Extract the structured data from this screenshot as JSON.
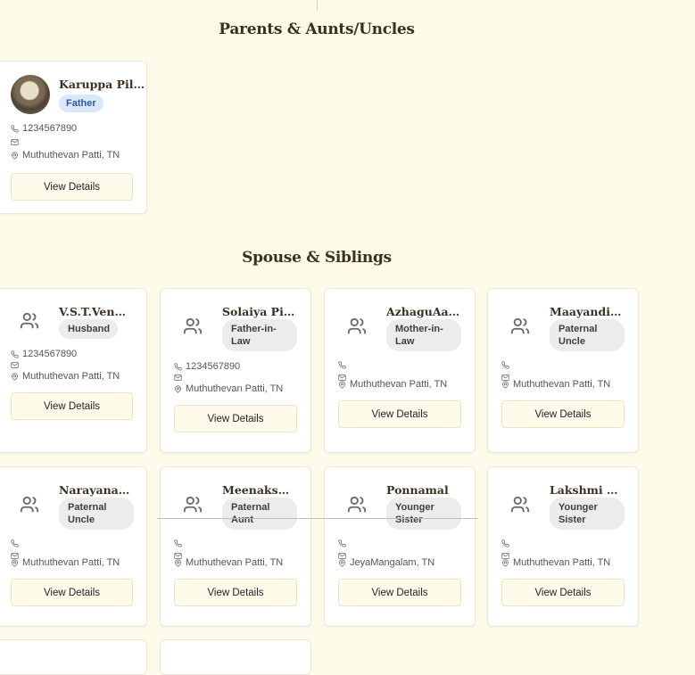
{
  "sections": {
    "parents": "Parents & Aunts/Uncles",
    "spouse": "Spouse & Siblings"
  },
  "view_details_label": "View Details",
  "icons": {
    "phone": "phone-icon",
    "email": "mail-icon",
    "location": "map-pin-icon",
    "avatar": "users-icon"
  },
  "colors": {
    "background": "#fefbea",
    "card": "#ffffff",
    "badge_blue_bg": "#dbe7fa",
    "badge_blue_text": "#2e59a8",
    "badge_gray_bg": "#ececec"
  },
  "parents": [
    {
      "name": "Karuppa Pillai",
      "relation": "Father",
      "phone": "1234567890",
      "email": "",
      "location": "Muthuthevan Patti, TN"
    }
  ],
  "spouse_siblings": [
    {
      "name": "V.S.T.Venkat...",
      "relation": "Husband",
      "phone": "1234567890",
      "email": "",
      "location": "Muthuthevan Patti, TN"
    },
    {
      "name": "Solaiya Pillai",
      "relation": "Father-in-Law",
      "phone": "1234567890",
      "email": "",
      "location": "Muthuthevan Patti, TN"
    },
    {
      "name": "AzhaguAaye...",
      "relation": "Mother-in-Law",
      "phone": "",
      "email": "",
      "location": "Muthuthevan Patti, TN"
    },
    {
      "name": "Maayandi Pi...",
      "relation": "Paternal Uncle",
      "phone": "",
      "email": "",
      "location": "Muthuthevan Patti, TN"
    },
    {
      "name": "Narayanan P...",
      "relation": "Paternal Uncle",
      "phone": "",
      "email": "",
      "location": "Muthuthevan Patti, TN"
    },
    {
      "name": "Meenakshi A...",
      "relation": "Paternal Aunt",
      "phone": "",
      "email": "",
      "location": "Muthuthevan Patti, TN"
    },
    {
      "name": "Ponnamal",
      "relation": "Younger Sister",
      "phone": "",
      "email": "",
      "location": "JeyaMangalam, TN"
    },
    {
      "name": "Lakshmi Am...",
      "relation": "Younger Sister",
      "phone": "",
      "email": "",
      "location": "Muthuthevan Patti, TN"
    }
  ]
}
